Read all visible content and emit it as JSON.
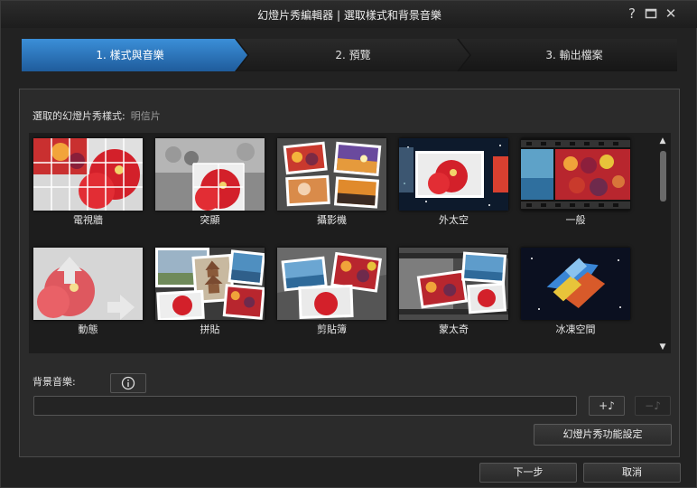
{
  "window": {
    "title": "幻燈片秀編輯器 | 選取樣式和背景音樂",
    "help_symbol": "?",
    "close_symbol": "✕"
  },
  "wizard": {
    "steps": [
      {
        "label": "1. 樣式與音樂",
        "active": true
      },
      {
        "label": "2. 預覽",
        "active": false
      },
      {
        "label": "3. 輸出檔案",
        "active": false
      }
    ]
  },
  "styles": {
    "selected_label": "選取的幻燈片秀樣式:",
    "selected_value": "明信片",
    "items": [
      {
        "label": "電視牆"
      },
      {
        "label": "突顯"
      },
      {
        "label": "攝影機"
      },
      {
        "label": "外太空"
      },
      {
        "label": "一般"
      },
      {
        "label": "動態"
      },
      {
        "label": "拼貼"
      },
      {
        "label": "剪貼簿"
      },
      {
        "label": "蒙太奇"
      },
      {
        "label": "冰凍空間"
      }
    ]
  },
  "scrollbar": {
    "up": "▲",
    "down": "▼"
  },
  "music": {
    "label": "背景音樂:",
    "field_value": "",
    "info_icon": "info-icon",
    "add_label": "+♪",
    "remove_label": "−♪"
  },
  "settings_button": "幻燈片秀功能設定",
  "footer": {
    "next": "下一步",
    "cancel": "取消"
  },
  "colors": {
    "accent": "#2e7bc9",
    "background": "#222222",
    "panel": "#2b2b2b"
  }
}
